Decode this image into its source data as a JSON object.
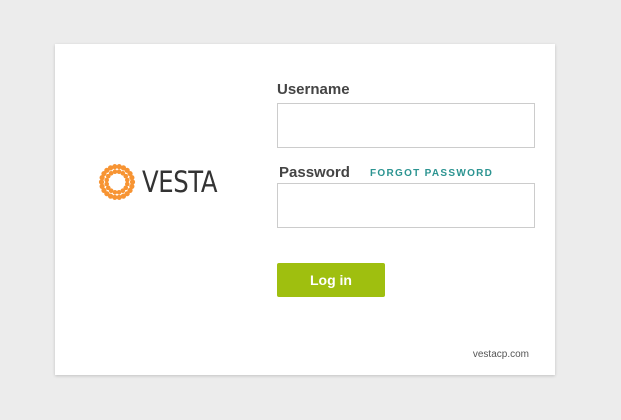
{
  "brand": {
    "name": "VESTA",
    "logo_icon": "dotted-ring-logo",
    "accent_color": "#f79433"
  },
  "login_form": {
    "username_label": "Username",
    "username_value": "",
    "password_label": "Password",
    "password_value": "",
    "forgot_password_label": "FORGOT PASSWORD",
    "submit_label": "Log in",
    "button_color": "#9fbf0f",
    "link_color": "#2c9491"
  },
  "footer": {
    "site_link": "vestacp.com"
  }
}
